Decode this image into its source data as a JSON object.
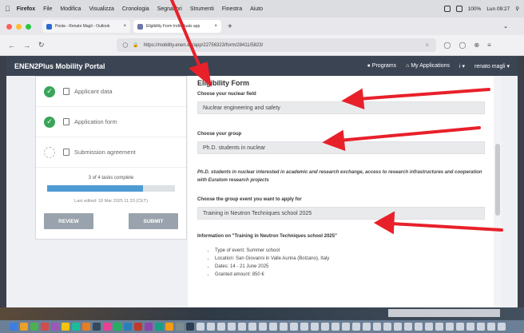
{
  "menubar": {
    "apple": "",
    "items": [
      "Firefox",
      "File",
      "Modifica",
      "Visualizza",
      "Cronologia",
      "Segnalibri",
      "Strumenti",
      "Finestra",
      "Aiuto"
    ],
    "battery": "100%",
    "clock": "Lun 09:27"
  },
  "browser": {
    "tabs": [
      {
        "label": "Posta - Renato Magli - Outlook"
      },
      {
        "label": "Eligibility Form Individuals app"
      }
    ],
    "url": "https://mobility.enen.eu/app/22756323/form/28411/5823/"
  },
  "app": {
    "brand": "ENEN2Plus Mobility Portal",
    "nav": {
      "programs": "Programs",
      "applications": "My Applications",
      "info": "i",
      "user": "renato magli"
    }
  },
  "sidebar": {
    "tasks": [
      {
        "label": "Applicant data",
        "status": "done"
      },
      {
        "label": "Application form",
        "status": "done"
      },
      {
        "label": "Submission agreement",
        "status": "pending"
      }
    ],
    "progress_text": "3 of 4 tasks complete",
    "progress_fraction": 0.75,
    "last_edited": "Last edited: 18 Mar 2025 11:33 (CET)",
    "review_label": "REVIEW",
    "submit_label": "SUBMIT"
  },
  "form": {
    "title": "Eligibility Form",
    "field_label": "Choose your nuclear field",
    "field_value": "Nuclear engineering and safety",
    "group_label": "Choose your group",
    "group_value": "Ph.D. students in nuclear",
    "group_desc": "Ph.D. students in nuclear interested in academic and research exchange, access to research infrastructures and cooperation with Euratom research projects",
    "event_label": "Choose the group event you want to apply for",
    "event_value": "Training in Neutron Techniques school 2025",
    "info_label": "Information on \"Training in Neutron Techniques school 2025\"",
    "info_items": [
      "Type of event: Summer school",
      "Location: San Giovanni in Valle Aurina (Bolzano), Italy",
      "Dates: 14 - 21 June 2025",
      "Granted amount: 850 €"
    ]
  },
  "colors": {
    "annotation": "#e8202a",
    "header": "#3b4453",
    "success": "#3aa55a",
    "progress": "#4e9bd4"
  }
}
